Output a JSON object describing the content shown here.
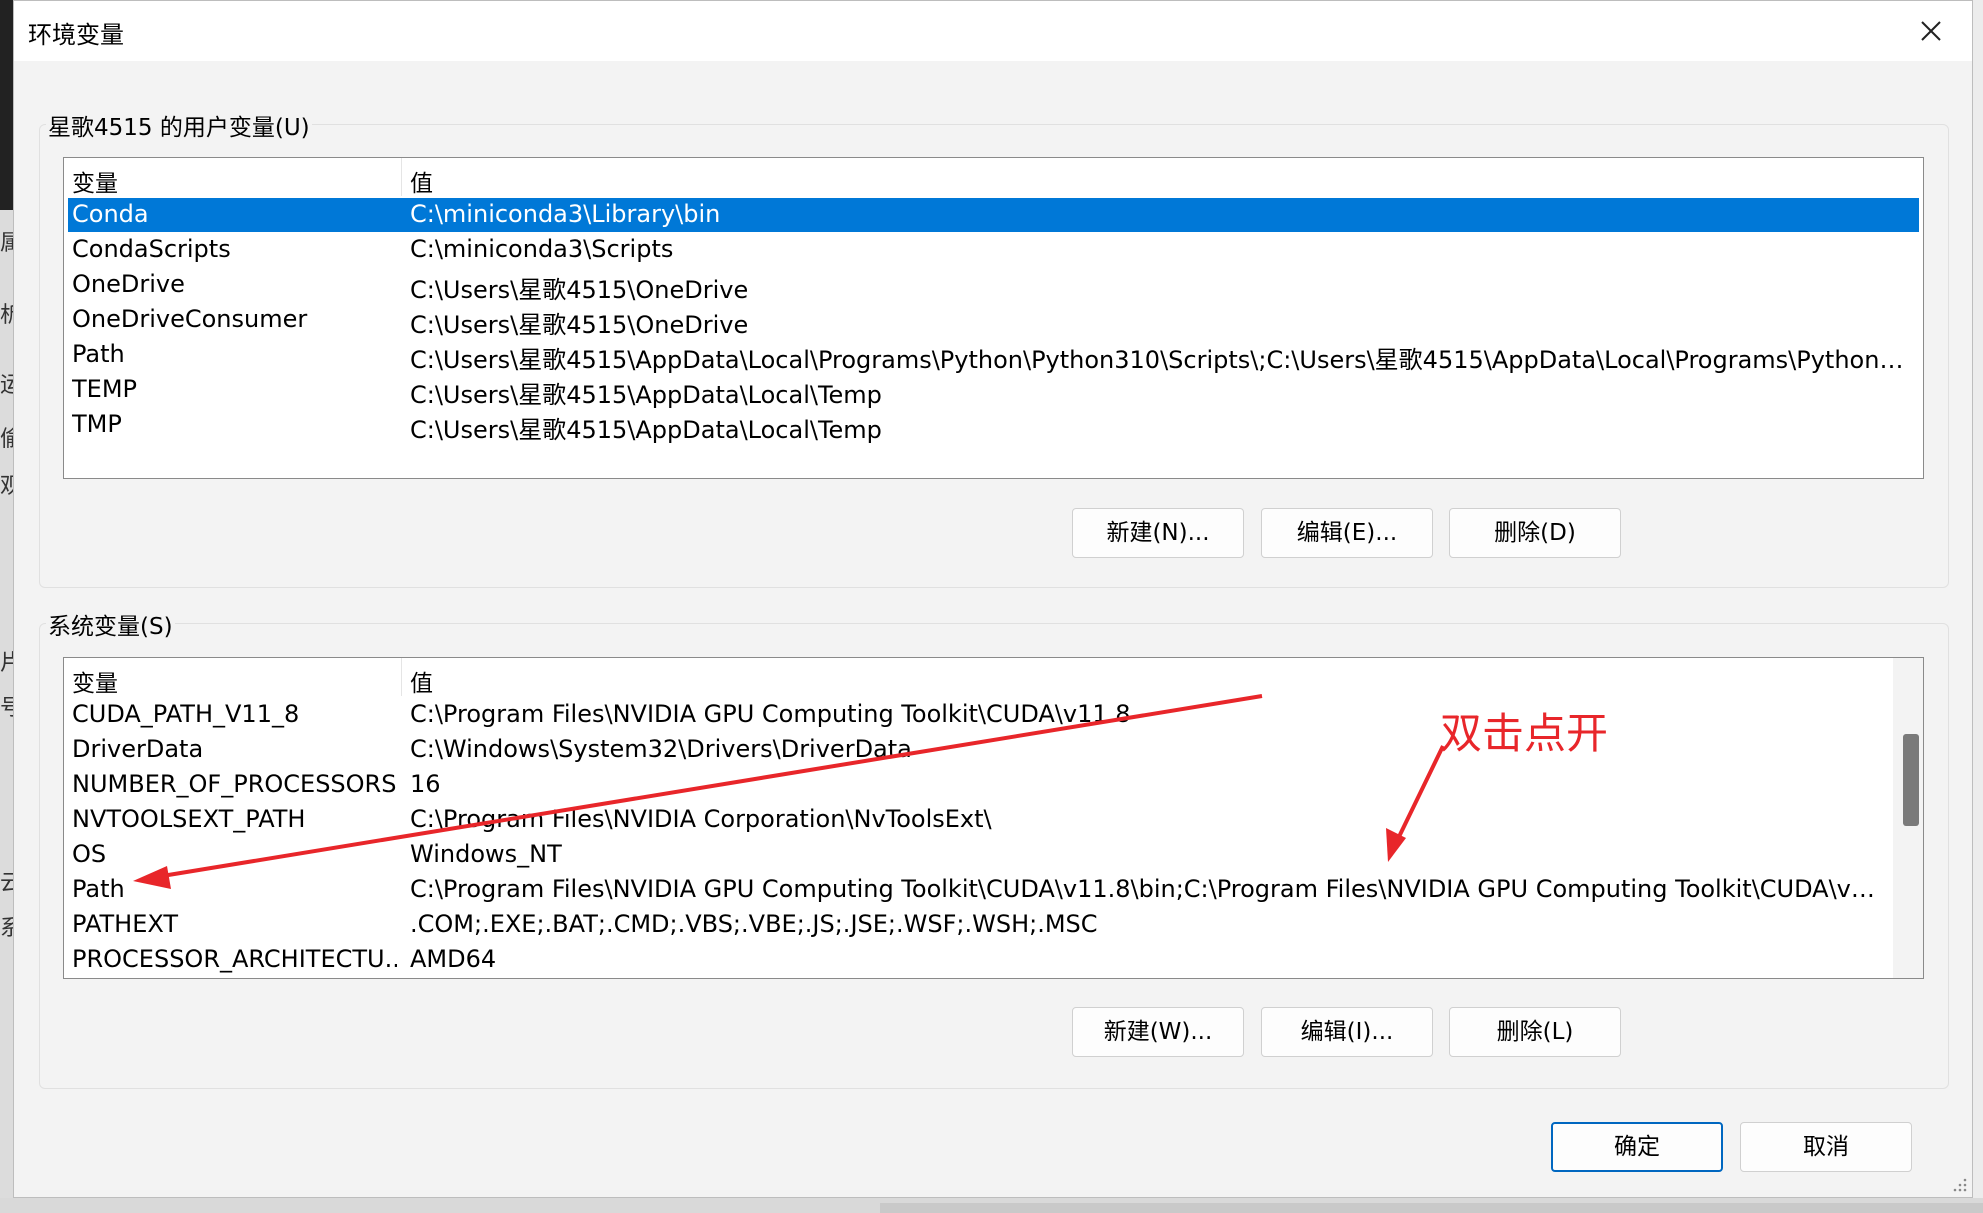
{
  "window": {
    "title": "环境变量"
  },
  "user_vars": {
    "group_label": "星歌4515 的用户变量(U)",
    "columns": {
      "name": "变量",
      "value": "值"
    },
    "rows": [
      {
        "name": "Conda",
        "value": "C:\\miniconda3\\Library\\bin",
        "selected": true
      },
      {
        "name": "CondaScripts",
        "value": "C:\\miniconda3\\Scripts"
      },
      {
        "name": "OneDrive",
        "value": "C:\\Users\\星歌4515\\OneDrive"
      },
      {
        "name": "OneDriveConsumer",
        "value": "C:\\Users\\星歌4515\\OneDrive"
      },
      {
        "name": "Path",
        "value": "C:\\Users\\星歌4515\\AppData\\Local\\Programs\\Python\\Python310\\Scripts\\;C:\\Users\\星歌4515\\AppData\\Local\\Programs\\Python\\Pyt..."
      },
      {
        "name": "TEMP",
        "value": "C:\\Users\\星歌4515\\AppData\\Local\\Temp"
      },
      {
        "name": "TMP",
        "value": "C:\\Users\\星歌4515\\AppData\\Local\\Temp"
      }
    ],
    "buttons": {
      "new": "新建(N)...",
      "edit": "编辑(E)...",
      "delete": "删除(D)"
    }
  },
  "system_vars": {
    "group_label": "系统变量(S)",
    "columns": {
      "name": "变量",
      "value": "值"
    },
    "rows": [
      {
        "name": "CUDA_PATH_V11_8",
        "value": "C:\\Program Files\\NVIDIA GPU Computing Toolkit\\CUDA\\v11.8"
      },
      {
        "name": "DriverData",
        "value": "C:\\Windows\\System32\\Drivers\\DriverData"
      },
      {
        "name": "NUMBER_OF_PROCESSORS",
        "value": "16"
      },
      {
        "name": "NVTOOLSEXT_PATH",
        "value": "C:\\Program Files\\NVIDIA Corporation\\NvToolsExt\\"
      },
      {
        "name": "OS",
        "value": "Windows_NT"
      },
      {
        "name": "Path",
        "value": "C:\\Program Files\\NVIDIA GPU Computing Toolkit\\CUDA\\v11.8\\bin;C:\\Program Files\\NVIDIA GPU Computing Toolkit\\CUDA\\v11..."
      },
      {
        "name": "PATHEXT",
        "value": ".COM;.EXE;.BAT;.CMD;.VBS;.VBE;.JS;.JSE;.WSF;.WSH;.MSC"
      },
      {
        "name": "PROCESSOR_ARCHITECTU...",
        "value": "AMD64"
      }
    ],
    "buttons": {
      "new": "新建(W)...",
      "edit": "编辑(I)...",
      "delete": "删除(L)"
    }
  },
  "footer": {
    "ok": "确定",
    "cancel": "取消"
  },
  "annotation": {
    "text": "双击点开",
    "color": "#e8262a"
  },
  "background_fragments": [
    "属",
    "析",
    "运",
    "偷",
    "观",
    "片",
    "号",
    "云",
    "系"
  ],
  "colors": {
    "selection": "#0078d7",
    "primary_border": "#0067c0"
  },
  "icons": {
    "close": "close-icon"
  }
}
